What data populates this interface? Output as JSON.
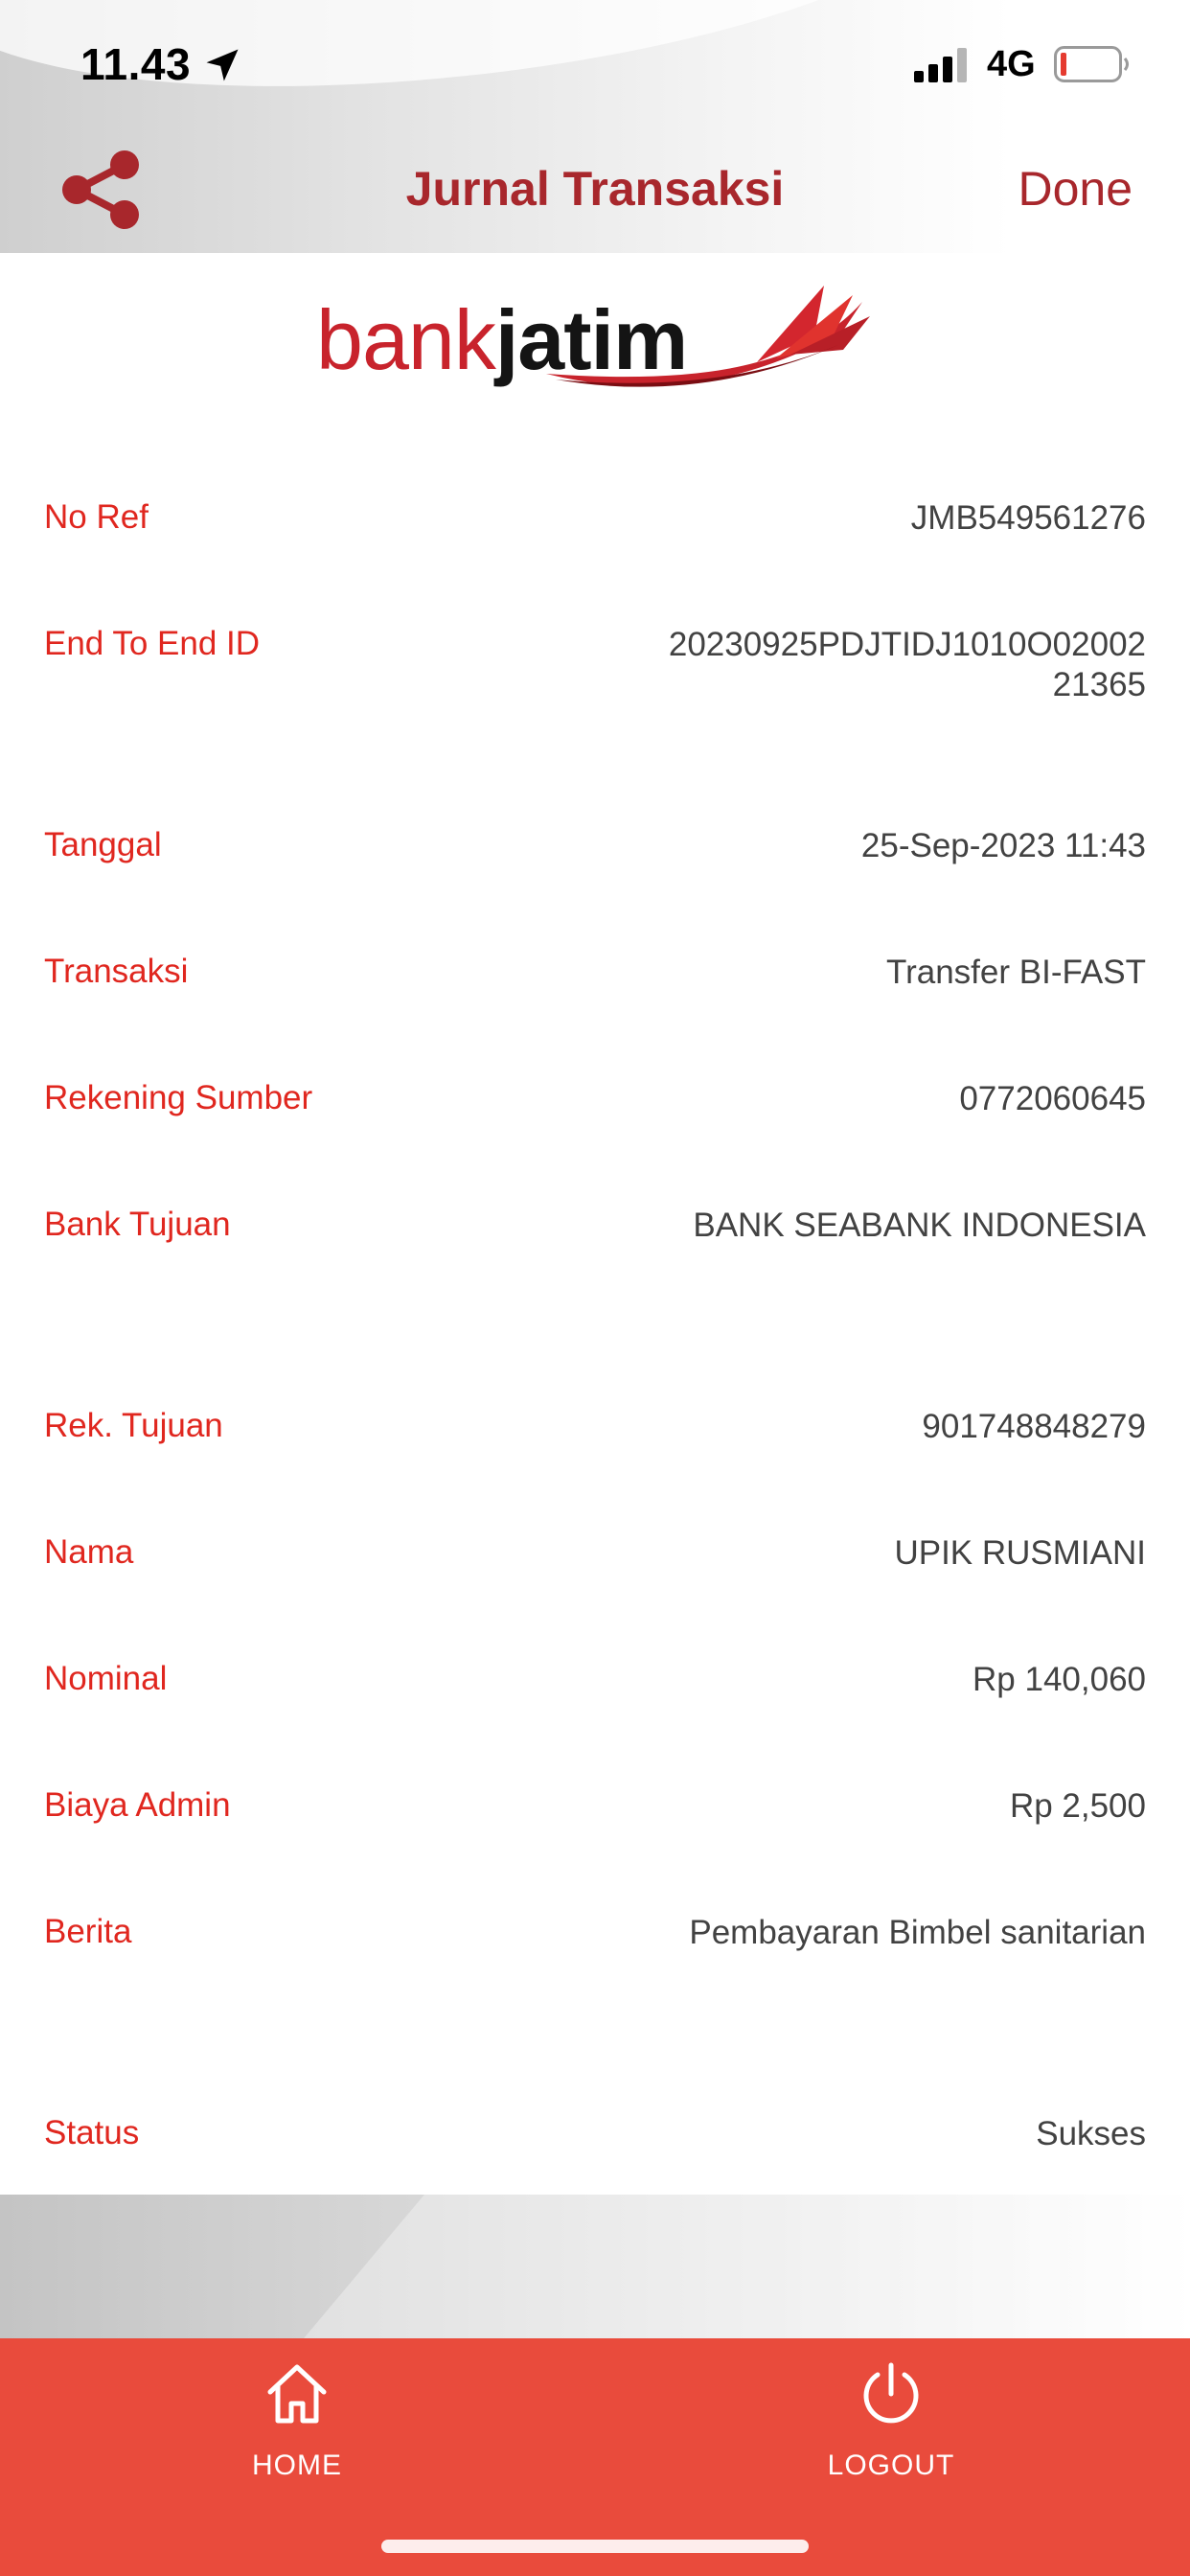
{
  "status_bar": {
    "time": "11.43",
    "network": "4G",
    "icons": [
      "location-arrow-icon",
      "cellular-signal-icon",
      "battery-low-icon"
    ]
  },
  "nav": {
    "title": "Jurnal Transaksi",
    "done_label": "Done",
    "share_icon": "share-icon",
    "accent_color": "#a8272c"
  },
  "logo": {
    "part1": "bank",
    "part2": "jatim"
  },
  "details": [
    {
      "label": "No Ref",
      "value": "JMB549561276"
    },
    {
      "label": "End To End ID",
      "value": "20230925PDJTIDJ1010O02002 21365"
    },
    {
      "label": "Tanggal",
      "value": "25-Sep-2023 11:43"
    },
    {
      "label": "Transaksi",
      "value": "Transfer BI-FAST"
    },
    {
      "label": "Rekening Sumber",
      "value": "0772060645"
    },
    {
      "label": "Bank Tujuan",
      "value": "BANK SEABANK INDONESIA"
    },
    {
      "label": "Rek. Tujuan",
      "value": "901748848279"
    },
    {
      "label": "Nama",
      "value": "UPIK RUSMIANI"
    },
    {
      "label": "Nominal",
      "value": "Rp 140,060"
    },
    {
      "label": "Biaya Admin",
      "value": "Rp 2,500"
    },
    {
      "label": "Berita",
      "value": "Pembayaran Bimbel sanitarian"
    },
    {
      "label": "Status",
      "value": "Sukses"
    }
  ],
  "colors": {
    "label": "#e0271f",
    "value": "#424242",
    "tab_bar": "#e94b3c"
  },
  "tab_bar": {
    "home_label": "HOME",
    "home_icon": "home-icon",
    "logout_label": "LOGOUT",
    "logout_icon": "power-icon"
  }
}
